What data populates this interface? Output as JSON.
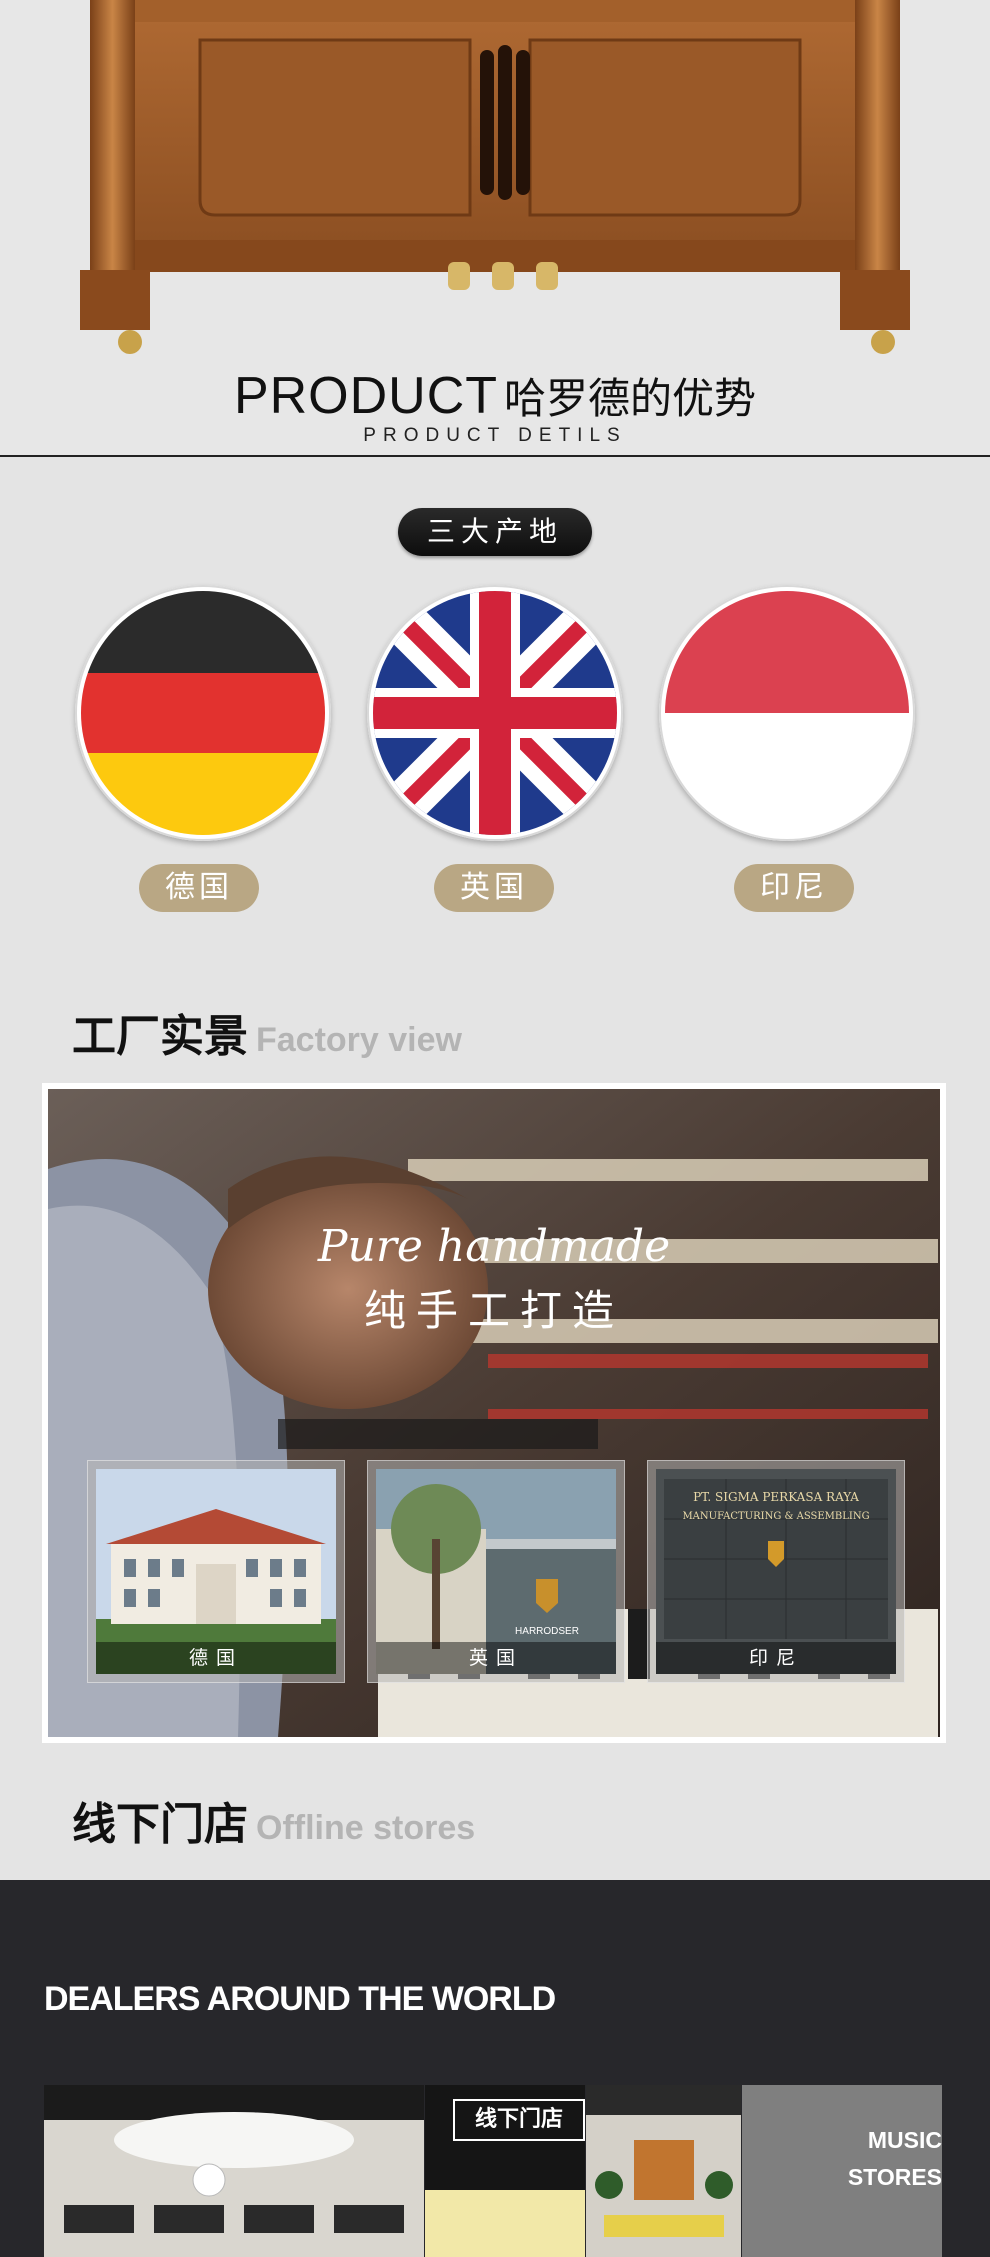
{
  "product": {
    "title_en": "PRODUCT",
    "title_cn": "哈罗德的优势",
    "subtitle": "PRODUCT DETILS"
  },
  "origins": {
    "badge": "三大产地",
    "countries": [
      {
        "label": "德国",
        "flag": "germany-flag-icon"
      },
      {
        "label": "英国",
        "flag": "uk-flag-icon"
      },
      {
        "label": "印尼",
        "flag": "indonesia-flag-icon"
      }
    ]
  },
  "factory": {
    "heading_cn": "工厂实景",
    "heading_en": "Factory view",
    "script_text": "Pure handmade",
    "cn_text": "纯手工打造",
    "thumbs": [
      {
        "label": "德国"
      },
      {
        "label": "英国",
        "sign": "HARRODSER"
      },
      {
        "label": "印尼",
        "sign_line1": "PT. SIGMA PERKASA RAYA",
        "sign_line2": "MANUFACTURING & ASSEMBLING"
      }
    ],
    "piano_brand": "HARRODSER"
  },
  "stores": {
    "heading_cn": "线下门店",
    "heading_en": "Offline stores",
    "dealers_title": "DEALERS AROUND THE WORLD",
    "stamp": "线下门店",
    "music_line1": "MUSIC",
    "music_line2": "STORES"
  },
  "colors": {
    "badge_bg": "#111111",
    "label_bg": "#b9a784",
    "dark_section": "#27272b"
  }
}
